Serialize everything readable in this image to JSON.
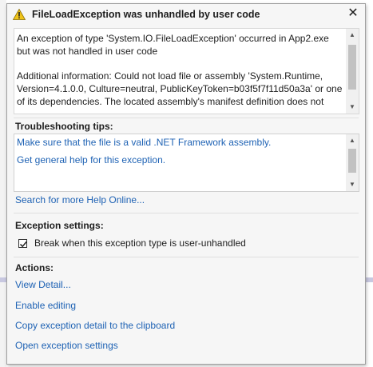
{
  "dialog": {
    "title": "FileLoadException was unhandled by user code",
    "close_symbol": "✕",
    "message_1": "An exception of type 'System.IO.FileLoadException' occurred in App2.exe but was not handled in user code",
    "message_2": "Additional information: Could not load file or assembly 'System.Runtime, Version=4.1.0.0, Culture=neutral, PublicKeyToken=b03f5f7f11d50a3a' or one of its dependencies. The located assembly's manifest definition does not",
    "troubleshooting_title": "Troubleshooting tips:",
    "tips": [
      "Make sure that the file is a valid .NET Framework assembly.",
      "Get general help for this exception."
    ],
    "search_link": "Search for more Help Online...",
    "exception_settings_title": "Exception settings:",
    "break_checkbox_label": "Break when this exception type is user-unhandled",
    "break_checked": true,
    "actions_title": "Actions:",
    "actions": [
      "View Detail...",
      "Enable editing",
      "Copy exception detail to the clipboard",
      "Open exception settings"
    ]
  },
  "colors": {
    "link": "#1e62b4",
    "warning": "#f0c419"
  }
}
